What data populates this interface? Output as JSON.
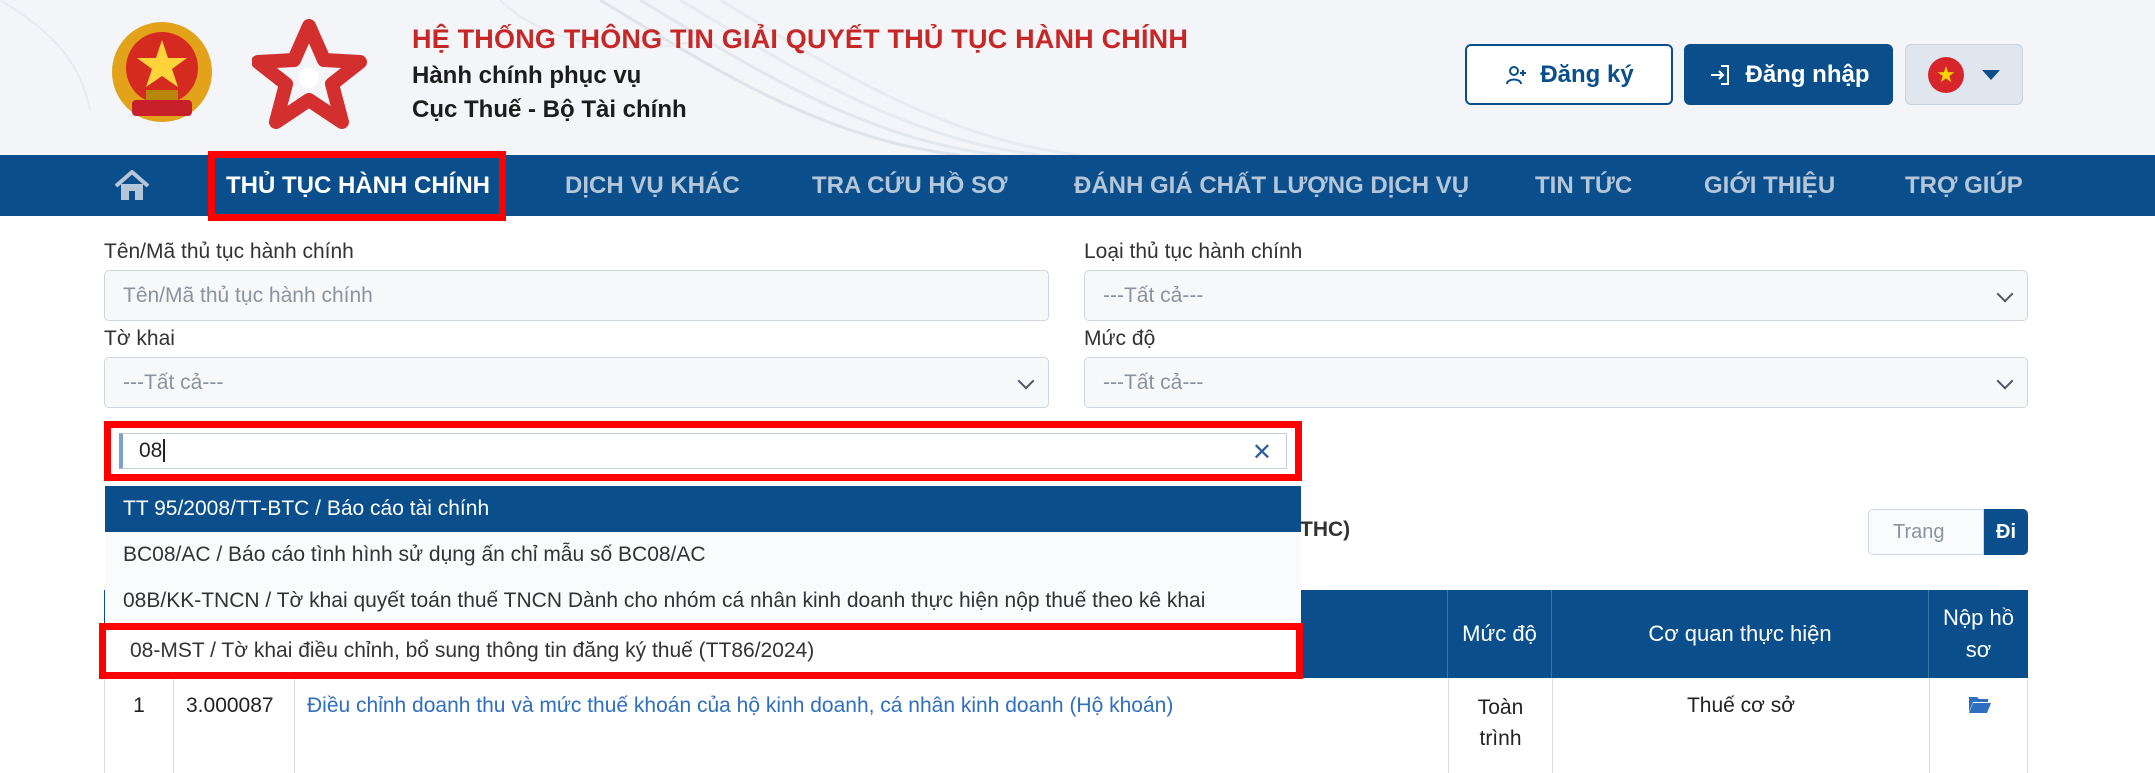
{
  "header": {
    "title": "HỆ THỐNG THÔNG TIN GIẢI QUYẾT THỦ TỤC HÀNH CHÍNH",
    "subtitle1": "Hành chính phục vụ",
    "subtitle2": "Cục Thuế - Bộ Tài chính",
    "register_label": "Đăng ký",
    "login_label": "Đăng nhập"
  },
  "nav": {
    "items": [
      {
        "label": "THỦ TỤC HÀNH CHÍNH"
      },
      {
        "label": "DỊCH VỤ KHÁC"
      },
      {
        "label": "TRA CỨU HỒ SƠ"
      },
      {
        "label": "ĐÁNH GIÁ CHẤT LƯỢNG DỊCH VỤ"
      },
      {
        "label": "TIN TỨC"
      },
      {
        "label": "GIỚI THIỆU"
      },
      {
        "label": "TRỢ GIÚP"
      }
    ]
  },
  "form": {
    "name_label": "Tên/Mã thủ tục hành chính",
    "name_placeholder": "Tên/Mã thủ tục hành chính",
    "type_label": "Loại thủ tục hành chính",
    "type_value": "---Tất cả---",
    "form_label": "Tờ khai",
    "form_value": "---Tất cả---",
    "level_label": "Mức độ",
    "level_value": "---Tất cả---"
  },
  "dropdown": {
    "search_value": "08",
    "options": [
      {
        "label": "TT 95/2008/TT-BTC / Báo cáo tài chính"
      },
      {
        "label": "BC08/AC / Báo cáo tình hình sử dụng ấn chỉ mẫu số BC08/AC"
      },
      {
        "label": "08B/KK-TNCN / Tờ khai quyết toán thuế TNCN Dành cho nhóm cá nhân kinh doanh thực hiện nộp thuế theo kê khai"
      },
      {
        "label": "08-MST / Tờ khai điều chỉnh, bổ sung thông tin đăng ký thuế (TT86/2024)"
      }
    ]
  },
  "toolbar": {
    "thc_fragment": "THC)",
    "page_placeholder": "Trang",
    "go_label": "Đi"
  },
  "table": {
    "headers": {
      "level": "Mức độ",
      "agency": "Cơ quan thực hiện",
      "submit": "Nộp hồ sơ"
    },
    "rows": [
      {
        "index": "1",
        "code": "3.000087",
        "name": "Điều chỉnh doanh thu và mức thuế khoán của hộ kinh doanh, cá nhân kinh doanh (Hộ khoán)",
        "level": "Toàn trình",
        "agency": "Thuế cơ sở"
      }
    ]
  },
  "colors": {
    "primary": "#0a4f8c",
    "title_red": "#c62828",
    "highlight": "#ff0000",
    "link": "#2f6fbf"
  }
}
